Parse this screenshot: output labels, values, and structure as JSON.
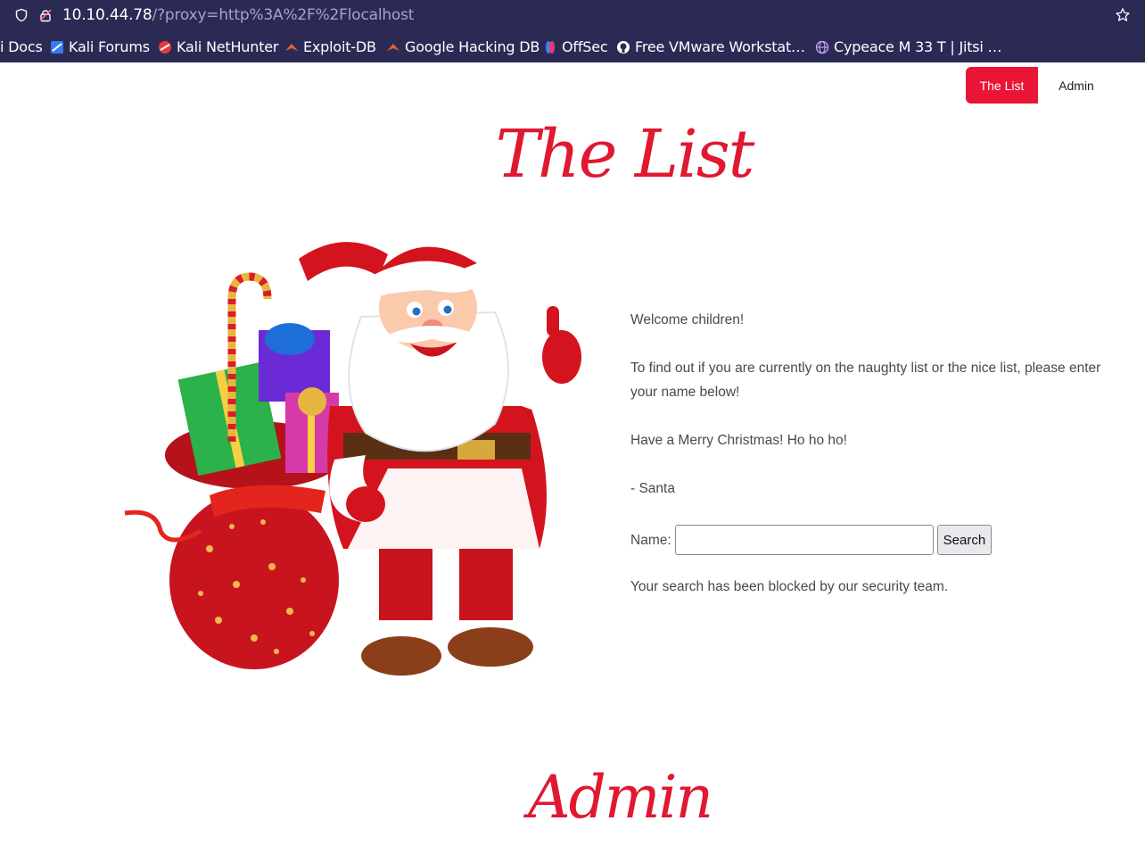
{
  "browser": {
    "url_host": "10.10.44.78",
    "url_rest": "/?proxy=http%3A%2F%2Flocalhost",
    "bookmarks": [
      {
        "label": "i Docs",
        "icon": "none"
      },
      {
        "label": "Kali Forums",
        "icon": "kali-icon"
      },
      {
        "label": "Kali NetHunter",
        "icon": "nethunter-icon"
      },
      {
        "label": "Exploit-DB",
        "icon": "exploitdb-icon"
      },
      {
        "label": "Google Hacking DB",
        "icon": "exploitdb-icon"
      },
      {
        "label": "OffSec",
        "icon": "offsec-icon"
      },
      {
        "label": "Free VMware Workstat…",
        "icon": "github-icon"
      },
      {
        "label": "Cypeace M 33 T | Jitsi …",
        "icon": "globe-icon"
      }
    ]
  },
  "nav": {
    "the_list": "The List",
    "admin": "Admin"
  },
  "page": {
    "title": "The List",
    "welcome": "Welcome children!",
    "instructions": "To find out if you are currently on the naughty list or the nice list, please enter your name below!",
    "greeting": "Have a Merry Christmas! Ho ho ho!",
    "signature": "- Santa",
    "name_label": "Name:",
    "search_button": "Search",
    "name_value": "",
    "result": "Your search has been blocked by our security team.",
    "admin_title": "Admin"
  },
  "colors": {
    "accent": "#ea1434",
    "chrome": "#2b2a55"
  }
}
